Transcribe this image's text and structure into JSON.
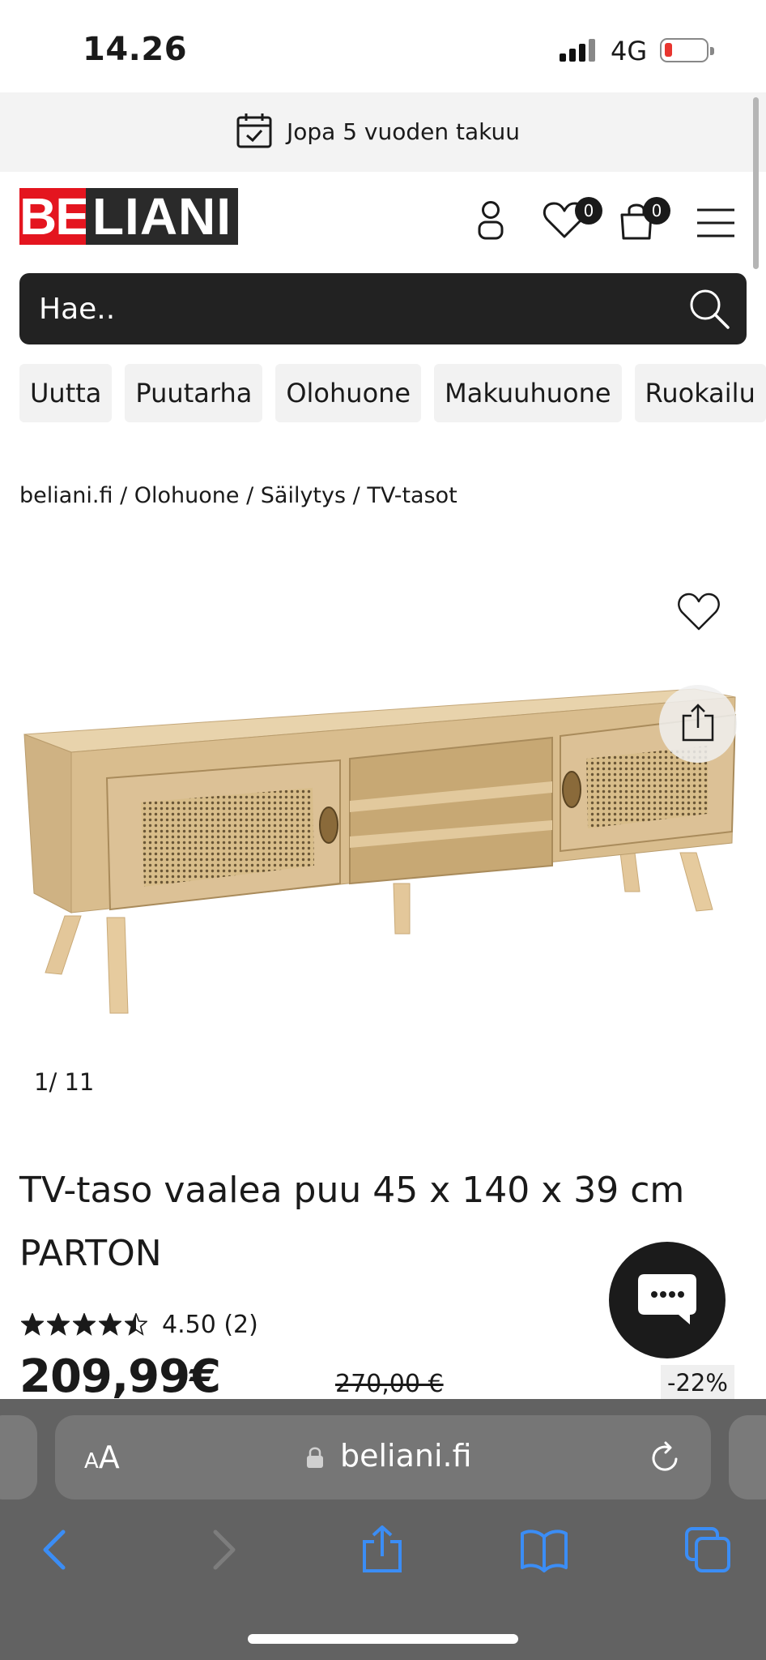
{
  "status_bar": {
    "time": "14.26",
    "network": "4G"
  },
  "promo": {
    "text": "Jopa 5 vuoden takuu"
  },
  "header": {
    "logo_part1": "BE",
    "logo_part2": "LIANI",
    "wishlist_count": "0",
    "cart_count": "0"
  },
  "search": {
    "placeholder": "Hae.."
  },
  "categories": [
    "Uutta",
    "Puutarha",
    "Olohuone",
    "Makuuhuone",
    "Ruokailu"
  ],
  "breadcrumb": "beliani.fi / Olohuone / Säilytys / TV-tasot",
  "gallery": {
    "counter": "1/  11"
  },
  "product": {
    "title": "TV-taso vaalea puu 45 x 140 x 39 cm PARTON",
    "rating": 4.5,
    "rating_text": "4.50 (2)",
    "price": "209,99€",
    "old_price": "270,00 €",
    "discount": "-22%"
  },
  "browser": {
    "url": "beliani.fi",
    "text_size_label": "AA"
  },
  "colors": {
    "brand_red": "#e4151f",
    "search_bg": "#222222",
    "safari_bar": "#626262",
    "safari_blue": "#3b8df5"
  }
}
